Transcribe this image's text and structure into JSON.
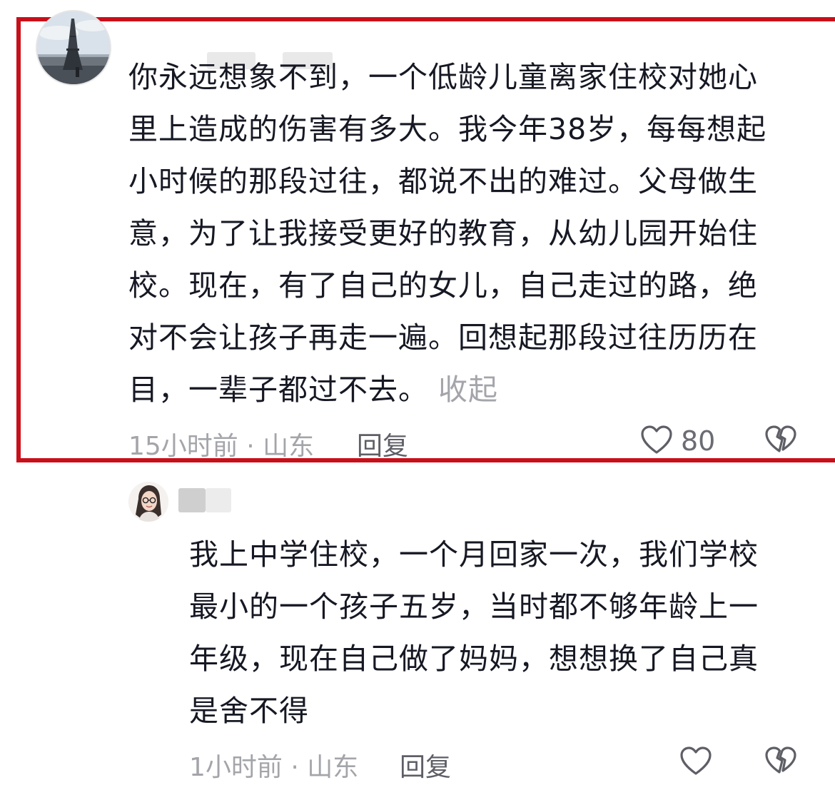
{
  "main_comment": {
    "text": "你永远想象不到，一个低龄儿童离家住校对她心\n里上造成的伤害有多大。我今年38岁，每每想起\n小时候的那段过往，都说不出的难过。父母做生\n意，为了让我接受更好的教育，从幼儿园开始住\n校。现在，有了自己的女儿，自己走过的路，绝\n对不会让孩子再走一遍。回想起那段过往历历在\n目，一辈子都过不去。",
    "collapse_label": "收起",
    "meta": "15小时前 · 山东",
    "reply_label": "回复",
    "like_count": "80",
    "highlight_color": "#c8101a"
  },
  "reply_comment": {
    "text": "我上中学住校，一个月回家一次，我们学校\n最小的一个孩子五岁，当时都不够年龄上一\n年级，现在自己做了妈妈，想想换了自己真\n是舍不得",
    "meta": "1小时前 · 山东",
    "reply_label": "回复"
  },
  "icons": {
    "like": "heart-outline-icon",
    "dislike": "broken-heart-icon"
  }
}
